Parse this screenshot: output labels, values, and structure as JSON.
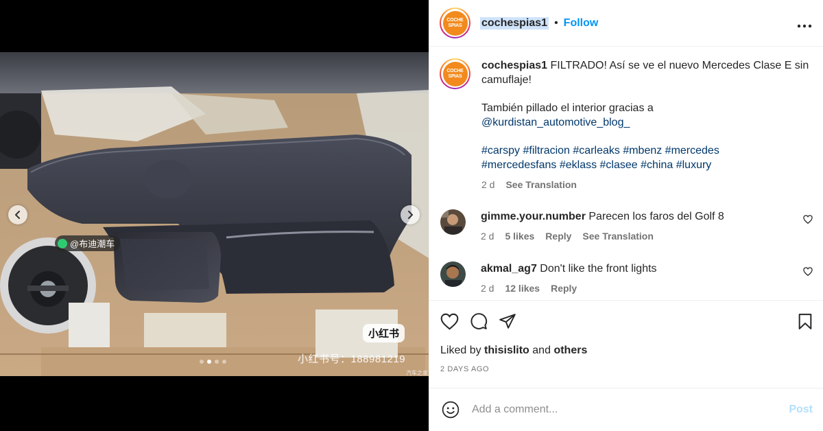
{
  "post": {
    "username": "cochespias1",
    "separator": "•",
    "follow_label": "Follow",
    "more_label": "•••",
    "logo_text_top": "COCHE",
    "logo_text_bottom": "SPIAS"
  },
  "media": {
    "watermark_badge": "小红书",
    "watermark_id": "小红书号：188981219",
    "watermark_tag": "@布迪潮车",
    "watermark_corner": "汽车之家",
    "carousel_dots": 4,
    "active_dot": 1,
    "icons": {
      "prev": "chevron-left-icon",
      "next": "chevron-right-icon"
    }
  },
  "caption": {
    "username": "cochespias1",
    "line1": "FILTRADO! Así se ve el nuevo Mercedes Clase E sin camuflaje!",
    "line2": "También pillado el interior gracias a",
    "mention": "@kurdistan_automotive_blog_",
    "hashtags1": "#carspy #filtracion #carleaks #mbenz #mercedes",
    "hashtags2": "#mercedesfans #eklass #clasee #china #luxury",
    "time": "2 d",
    "see_translation": "See Translation"
  },
  "comments": [
    {
      "username": "gimme.your.number",
      "text": "Parecen los faros del Golf 8",
      "time": "2 d",
      "likes": "5 likes",
      "reply": "Reply",
      "see_translation": "See Translation"
    },
    {
      "username": "akmal_ag7",
      "text": "Don't like the front lights",
      "time": "2 d",
      "likes": "12 likes",
      "reply": "Reply"
    }
  ],
  "actions": {
    "liked_prefix": "Liked by",
    "liked_user": "thisislito",
    "liked_and": "and",
    "liked_others": "others",
    "date": "2 DAYS AGO",
    "icons": [
      "heart-icon",
      "comment-icon",
      "share-icon",
      "bookmark-icon"
    ]
  },
  "add_comment": {
    "placeholder": "Add a comment...",
    "post_label": "Post"
  },
  "colors": {
    "link_blue": "#0095f6",
    "mention_blue": "#00376b",
    "secondary_text": "#737373",
    "post_disabled": "#b2dffc",
    "brand_orange": "#f28a1e"
  }
}
